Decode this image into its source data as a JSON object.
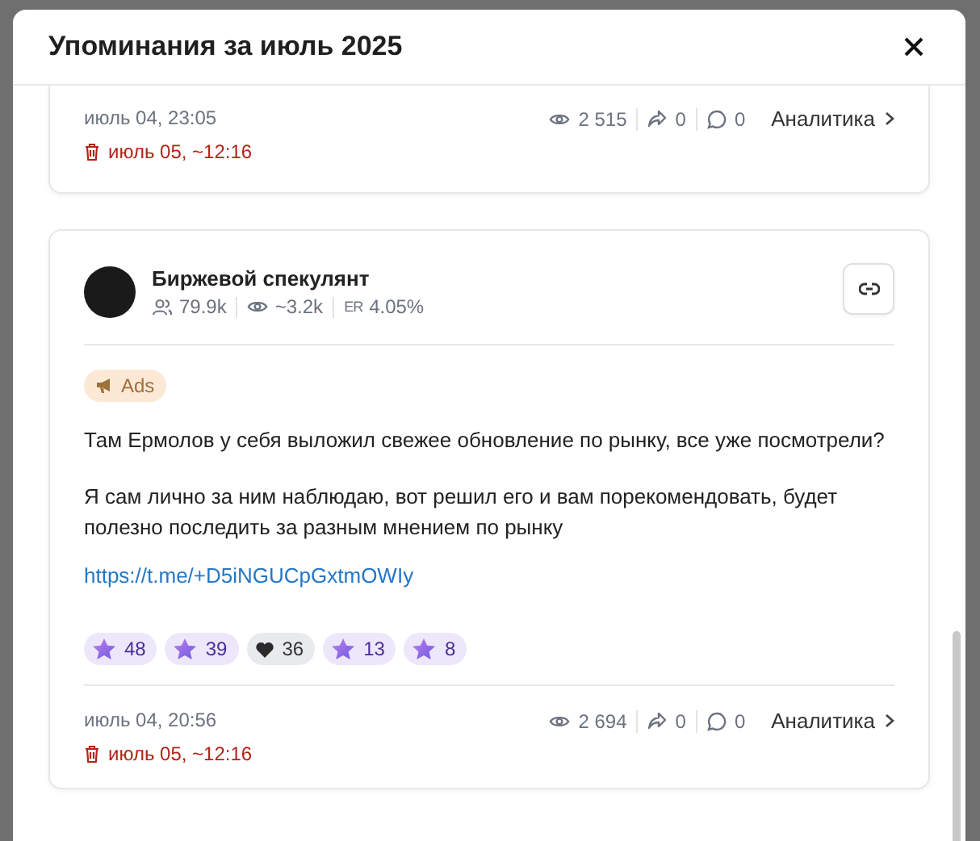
{
  "modal": {
    "title": "Упоминания за июль 2025"
  },
  "previous_post": {
    "footer": {
      "date": "июль 04, 23:05",
      "deleted_at": "июль 05, ~12:16",
      "views": "2 515",
      "shares": "0",
      "comments": "0",
      "analytics": "Аналитика"
    }
  },
  "post": {
    "channel": {
      "name": "Биржевой спекулянт",
      "subscribers": "79.9k",
      "reach": "~3.2k",
      "er_label": "ER",
      "er": "4.05%"
    },
    "tag": "Ads",
    "paragraphs": [
      "Там Ермолов у себя выложил свежее обновление по рынку, все уже посмотрели?",
      "Я сам лично за ним наблюдаю, вот решил его и вам порекомендовать, будет полезно последить за разным мнением по рынку"
    ],
    "link": "https://t.me/+D5iNGUCpGxtmOWIy",
    "reactions": [
      {
        "kind": "star",
        "count": "48"
      },
      {
        "kind": "star",
        "count": "39"
      },
      {
        "kind": "heart",
        "count": "36"
      },
      {
        "kind": "star",
        "count": "13"
      },
      {
        "kind": "star",
        "count": "8"
      }
    ],
    "footer": {
      "date": "июль 04, 20:56",
      "deleted_at": "июль 05, ~12:16",
      "views": "2 694",
      "shares": "0",
      "comments": "0",
      "analytics": "Аналитика"
    }
  }
}
